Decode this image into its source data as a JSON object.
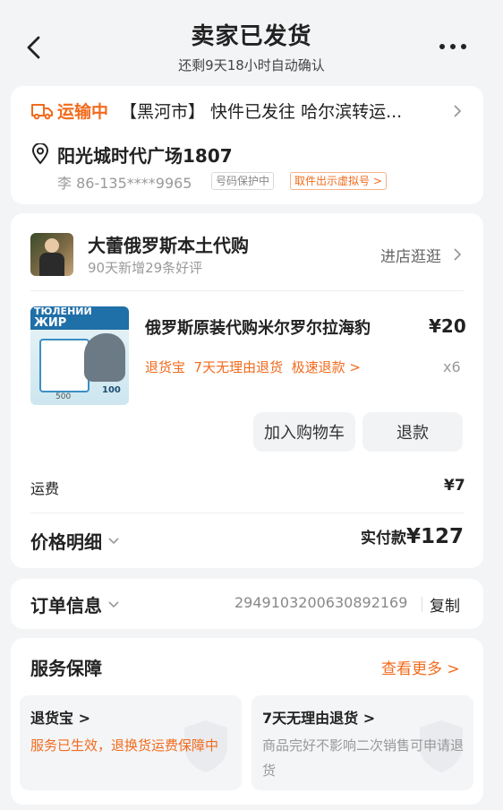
{
  "header": {
    "title": "卖家已发货",
    "subtitle": "还剩9天18小时自动确认"
  },
  "logistics": {
    "status": "运输中",
    "detail": "【黑河市】 快件已发往 哈尔滨转运..."
  },
  "address": {
    "place": "阳光城时代广场1807",
    "contact": "李 86-135****9965",
    "tag_protect": "号码保护中",
    "tag_virtual": "取件出示虚拟号 >"
  },
  "shop": {
    "name": "大蕾俄罗斯本土代购",
    "sub": "90天新增29条好评",
    "enter": "进店逛逛"
  },
  "product": {
    "title": "俄罗斯原装代购米尔罗尔拉海豹",
    "price": "¥20",
    "services": "退货宝  7天无理由退货  极速退款 >",
    "qty": "x6",
    "img_text_1": "ТЮЛЕНИЙ",
    "img_text_2": "ЖИР",
    "img_text_3": "100",
    "img_text_4": "500"
  },
  "actions": {
    "add_cart": "加入购物车",
    "refund": "退款"
  },
  "shipping": {
    "label": "运费",
    "value": "¥7"
  },
  "price": {
    "label": "价格明细",
    "paid_label": "实付款",
    "paid_value": "¥127"
  },
  "order": {
    "label": "订单信息",
    "number": "2949103200630892169",
    "copy": "复制"
  },
  "service": {
    "title": "服务保障",
    "more": "查看更多 >",
    "card1_title": "退货宝 >",
    "card1_desc": "服务已生效，退换货运费保障中",
    "card2_title": "7天无理由退货 >",
    "card2_desc": "商品完好不影响二次销售可申请退货"
  },
  "colors": {
    "accent": "#f26b1d",
    "background": "#f3f4f6"
  }
}
